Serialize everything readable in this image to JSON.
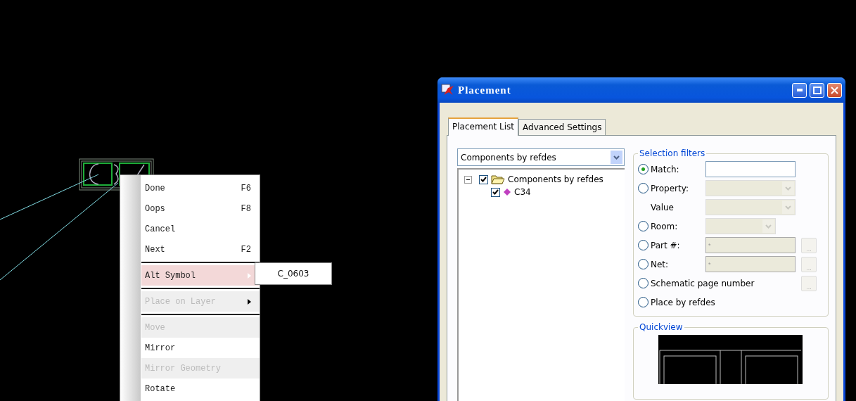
{
  "context_menu": {
    "items": [
      {
        "kind": "item",
        "label": "Done",
        "shortcut": "F6",
        "disabled": false,
        "selected": false
      },
      {
        "kind": "item",
        "label": "Oops",
        "shortcut": "F8",
        "disabled": false,
        "selected": false
      },
      {
        "kind": "item",
        "label": "Cancel",
        "disabled": false,
        "selected": false
      },
      {
        "kind": "item",
        "label": "Next",
        "shortcut": "F2",
        "disabled": false,
        "selected": false
      },
      {
        "kind": "separator"
      },
      {
        "kind": "submenu",
        "label": "Alt Symbol",
        "disabled": false,
        "selected": true
      },
      {
        "kind": "separator"
      },
      {
        "kind": "submenu",
        "label": "Place on Layer",
        "disabled": true,
        "selected": false
      },
      {
        "kind": "separator"
      },
      {
        "kind": "item",
        "label": "Move",
        "disabled": true,
        "selected": false
      },
      {
        "kind": "item",
        "label": "Mirror",
        "disabled": false,
        "selected": false
      },
      {
        "kind": "item",
        "label": "Mirror Geometry",
        "disabled": true,
        "selected": false
      },
      {
        "kind": "item",
        "label": "Rotate",
        "disabled": false,
        "selected": false
      }
    ],
    "submenu": {
      "items": [
        "C_0603"
      ]
    }
  },
  "window": {
    "title": "Placement"
  },
  "tabs": [
    {
      "label": "Placement List",
      "selected": true
    },
    {
      "label": "Advanced Settings",
      "selected": false
    }
  ],
  "list_mode": {
    "value": "Components by refdes"
  },
  "tree": [
    {
      "label": "Components by refdes",
      "checked": true,
      "expanded": true,
      "children": [
        {
          "label": "C34",
          "checked": true
        }
      ]
    }
  ],
  "selection_filters": {
    "title": "Selection filters",
    "rows": [
      {
        "kind": "radio",
        "label": "Match:",
        "selected": true,
        "control": {
          "kind": "text",
          "disabled": false
        }
      },
      {
        "kind": "radio",
        "label": "Property:",
        "selected": false,
        "control": {
          "kind": "combo",
          "disabled": true
        }
      },
      {
        "kind": "label",
        "label": "Value",
        "control": {
          "kind": "combo",
          "disabled": true
        }
      },
      {
        "kind": "radio",
        "label": "Room:",
        "selected": false,
        "control": {
          "kind": "short_combo",
          "disabled": true
        }
      },
      {
        "kind": "radio",
        "label": "Part #:",
        "selected": false,
        "control": {
          "kind": "text",
          "value": "*",
          "disabled": true
        },
        "browse": "..."
      },
      {
        "kind": "radio",
        "label": "Net:",
        "selected": false,
        "control": {
          "kind": "text",
          "value": "*",
          "disabled": true
        },
        "browse": "..."
      },
      {
        "kind": "radio",
        "label": "Schematic page number",
        "selected": false,
        "browse": "..."
      },
      {
        "kind": "radio",
        "label": "Place by refdes",
        "selected": false
      }
    ]
  },
  "quickview": {
    "title": "Quickview"
  }
}
